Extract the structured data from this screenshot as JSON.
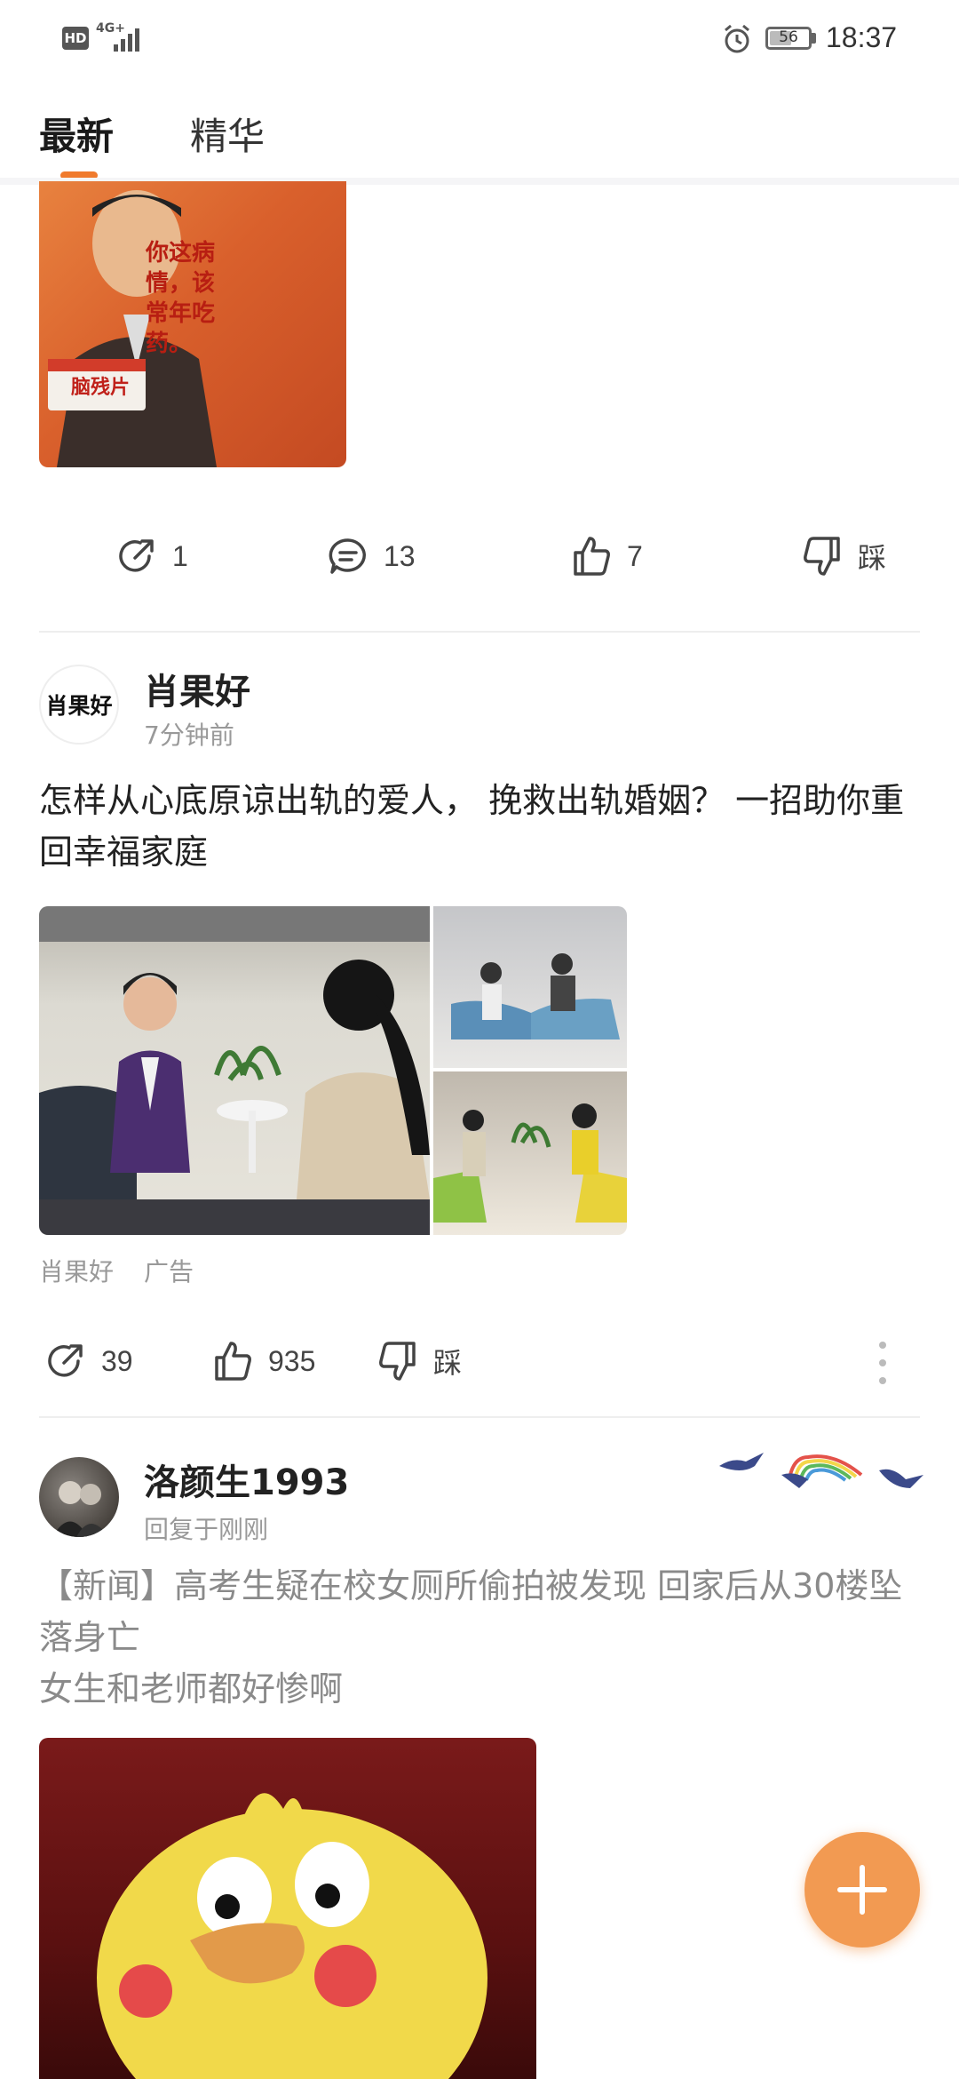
{
  "status_bar": {
    "hd": "HD",
    "network": "4G+",
    "battery": "56",
    "battery_level": 0.56,
    "time": "18:37"
  },
  "tabs": [
    {
      "label": "最新",
      "active": true
    },
    {
      "label": "精华",
      "active": false
    }
  ],
  "post1": {
    "image_text": "你这病情，该常年吃药。",
    "image_box_text": "脑残片",
    "actions": {
      "share": "1",
      "comment": "13",
      "like": "7",
      "dislike": "踩"
    }
  },
  "post2": {
    "avatar_text": "肖果好",
    "username": "肖果好",
    "time": "7分钟前",
    "text": "怎样从心底原谅出轨的爱人， 挽救出轨婚姻？ 一招助你重回幸福家庭",
    "ad_source": "肖果好",
    "ad_label": "广告",
    "actions": {
      "share": "39",
      "like": "935",
      "dislike": "踩"
    }
  },
  "post3": {
    "username": "洛颜生1993",
    "meta": "回复于刚刚",
    "text_line1": "【新闻】高考生疑在校女厕所偷拍被发现 回家后从30楼坠落身亡",
    "text_line2": "女生和老师都好惨啊"
  },
  "colors": {
    "accent": "#f07a2c",
    "fab": "#f29a52"
  },
  "icons": [
    "share-icon",
    "comment-icon",
    "thumbs-up-icon",
    "thumbs-down-icon",
    "more-vertical-icon",
    "plus-icon",
    "alarm-icon",
    "signal-icon"
  ]
}
